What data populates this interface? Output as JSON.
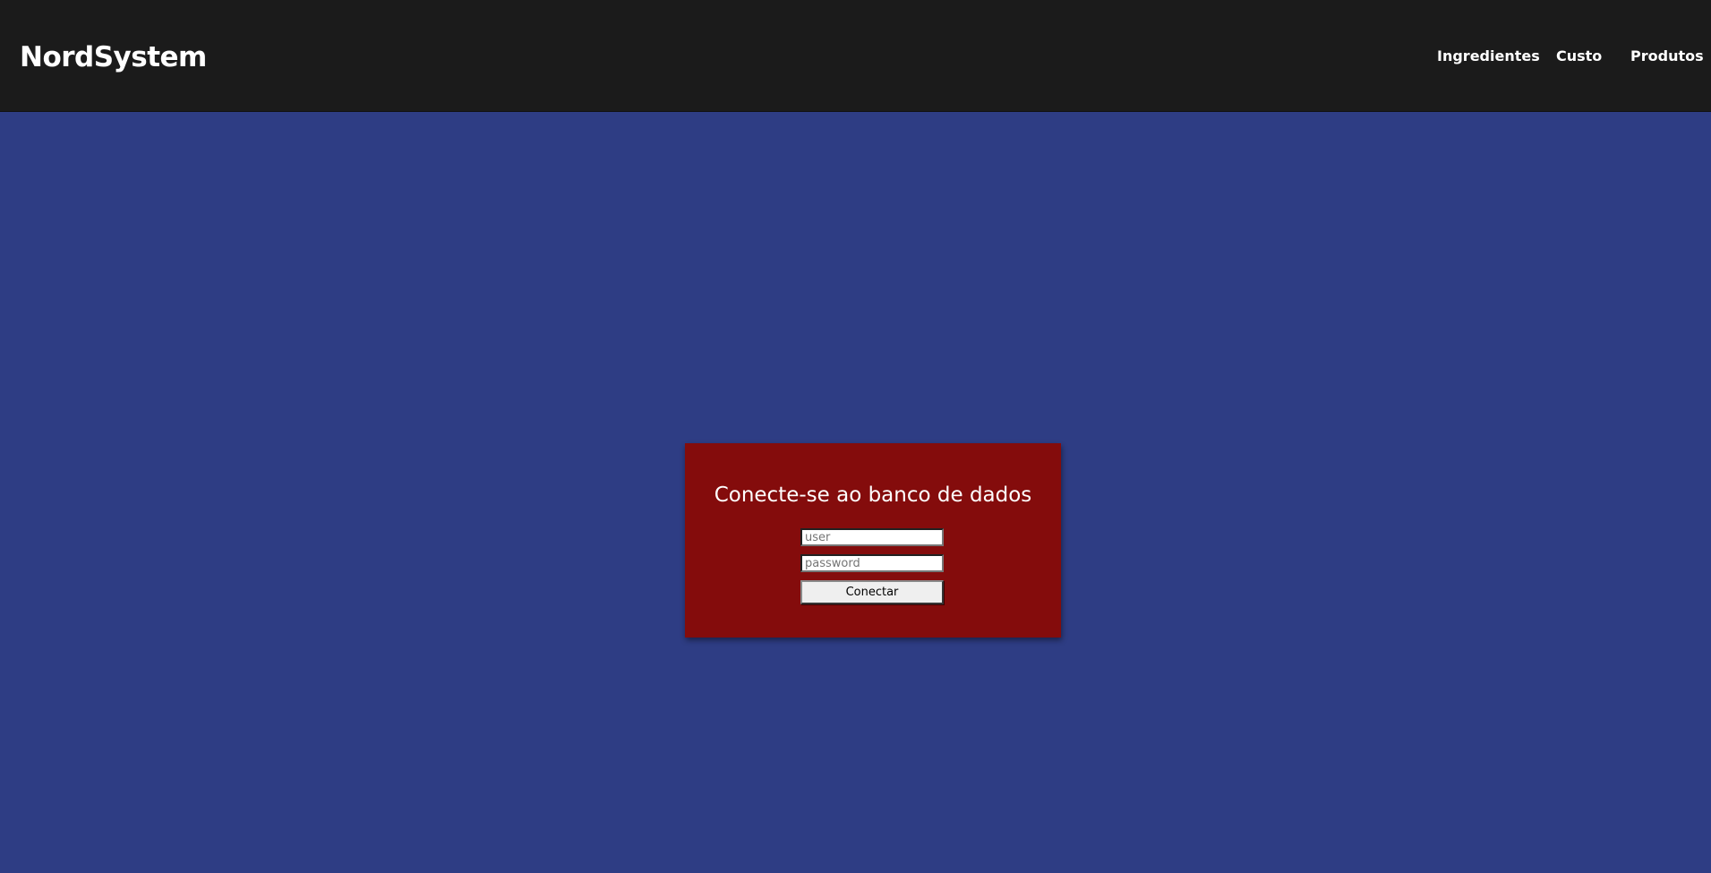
{
  "header": {
    "brand": "NordSystem",
    "nav": [
      {
        "label": "Ingredientes"
      },
      {
        "label": "Custo"
      },
      {
        "label": "Produtos"
      }
    ]
  },
  "login": {
    "title": "Conecte-se ao banco de dados",
    "user_placeholder": "user",
    "user_value": "",
    "password_placeholder": "password",
    "password_value": "",
    "connect_label": "Conectar"
  },
  "colors": {
    "header_bg": "#1b1b1b",
    "page_bg": "#2e3d84",
    "card_bg": "#840c0c",
    "text_light": "#ffffff"
  }
}
